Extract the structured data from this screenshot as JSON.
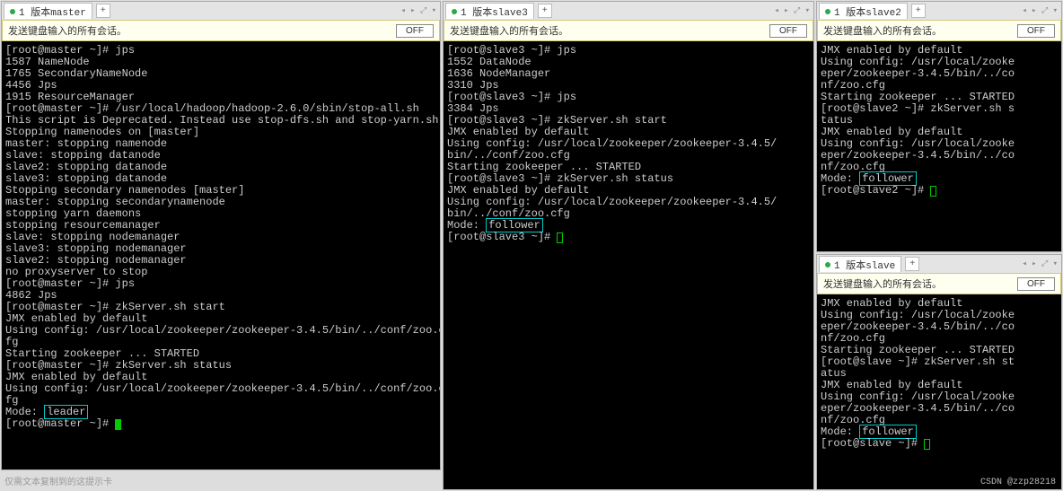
{
  "common": {
    "bar_text": "发送键盘输入的所有会话。",
    "off_label": "OFF",
    "add_tab": "+",
    "ctrl_icons": "◂ ▸ ⤢ ▾"
  },
  "pane_master": {
    "tab": "1 版本master",
    "mode_prefix": "Mode: ",
    "mode_val": "leader",
    "lines_a": "[root@master ~]# jps\n1587 NameNode\n1765 SecondaryNameNode\n4456 Jps\n1915 ResourceManager\n[root@master ~]# /usr/local/hadoop/hadoop-2.6.0/sbin/stop-all.sh\nThis script is Deprecated. Instead use stop-dfs.sh and stop-yarn.sh\nStopping namenodes on [master]\nmaster: stopping namenode\nslave: stopping datanode\nslave2: stopping datanode\nslave3: stopping datanode\nStopping secondary namenodes [master]\nmaster: stopping secondarynamenode\nstopping yarn daemons\nstopping resourcemanager\nslave: stopping nodemanager\nslave3: stopping nodemanager\nslave2: stopping nodemanager\nno proxyserver to stop\n[root@master ~]# jps\n4862 Jps\n[root@master ~]# zkServer.sh start\nJMX enabled by default\nUsing config: /usr/local/zookeeper/zookeeper-3.4.5/bin/../conf/zoo.c\nfg\nStarting zookeeper ... STARTED\n[root@master ~]# zkServer.sh status\nJMX enabled by default\nUsing config: /usr/local/zookeeper/zookeeper-3.4.5/bin/../conf/zoo.c\nfg",
    "lines_b": "[root@master ~]# "
  },
  "pane_slave3": {
    "tab": "1 版本slave3",
    "mode_prefix": "Mode: ",
    "mode_val": "follower",
    "lines_a": "[root@slave3 ~]# jps\n1552 DataNode\n1636 NodeManager\n3310 Jps\n[root@slave3 ~]# jps\n3384 Jps\n[root@slave3 ~]# zkServer.sh start\nJMX enabled by default\nUsing config: /usr/local/zookeeper/zookeeper-3.4.5/\nbin/../conf/zoo.cfg\nStarting zookeeper ... STARTED\n[root@slave3 ~]# zkServer.sh status\nJMX enabled by default\nUsing config: /usr/local/zookeeper/zookeeper-3.4.5/\nbin/../conf/zoo.cfg",
    "lines_b": "[root@slave3 ~]# "
  },
  "pane_slave2": {
    "tab": "1 版本slave2",
    "mode_prefix": "Mode: ",
    "mode_val": "follower",
    "lines_a": "JMX enabled by default\nUsing config: /usr/local/zooke\neper/zookeeper-3.4.5/bin/../co\nnf/zoo.cfg\nStarting zookeeper ... STARTED\n[root@slave2 ~]# zkServer.sh s\ntatus\nJMX enabled by default\nUsing config: /usr/local/zooke\neper/zookeeper-3.4.5/bin/../co\nnf/zoo.cfg",
    "lines_b": "[root@slave2 ~]# "
  },
  "pane_slave": {
    "tab": "1 版本slave",
    "mode_prefix": "Mode: ",
    "mode_val": "follower",
    "lines_a": "JMX enabled by default\nUsing config: /usr/local/zooke\neper/zookeeper-3.4.5/bin/../co\nnf/zoo.cfg\nStarting zookeeper ... STARTED\n[root@slave ~]# zkServer.sh st\natus\nJMX enabled by default\nUsing config: /usr/local/zooke\neper/zookeeper-3.4.5/bin/../co\nnf/zoo.cfg",
    "lines_b": "[root@slave ~]# "
  },
  "watermark": "CSDN @zzp28218",
  "footer_hint": "仅需文本复制到的这提示卡"
}
